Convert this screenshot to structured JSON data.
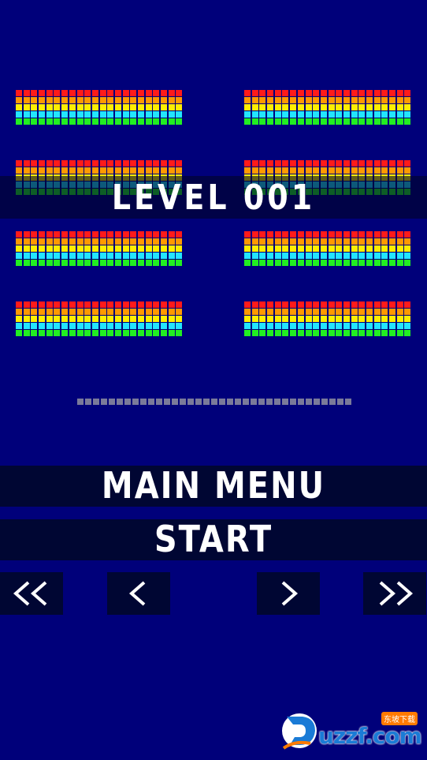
{
  "game": {
    "level_label": "LEVEL 001",
    "bricks": {
      "columns": 22,
      "row_colors": [
        "#ff1a1a",
        "#ff9900",
        "#ffee00",
        "#22e5ff",
        "#22ee22"
      ],
      "blocks": 8
    },
    "paddle_segments": 35,
    "paddle_color": "#7a7a9a"
  },
  "menu": {
    "main_menu_label": "MAIN MENU",
    "start_label": "START"
  },
  "nav": {
    "first_icon": "double-chevron-left-icon",
    "prev_icon": "chevron-left-icon",
    "next_icon": "chevron-right-icon",
    "last_icon": "double-chevron-right-icon"
  },
  "watermark": {
    "brand": "uzzf",
    "domain": ".com",
    "tagline": "东坡下载"
  },
  "colors": {
    "background": "#00007a",
    "bar": "#000633",
    "text": "#ffffff"
  }
}
